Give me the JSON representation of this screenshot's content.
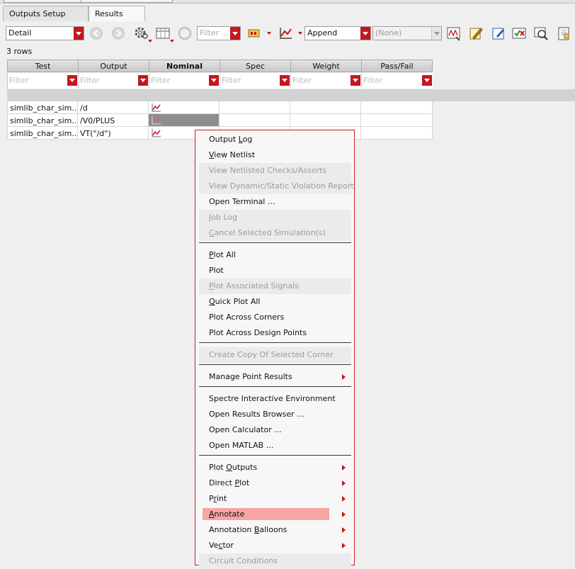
{
  "tabs": [
    {
      "label": "Outputs Setup"
    },
    {
      "label": "Results",
      "active": true
    }
  ],
  "toolbar": {
    "view_select": "Detail",
    "filter_placeholder": "Filter ...",
    "mode_select": "Append",
    "history_select": "(None)"
  },
  "row_count": "3 rows",
  "table": {
    "columns": [
      "Test",
      "Output",
      "Nominal",
      "Spec",
      "Weight",
      "Pass/Fail"
    ],
    "filter_placeholder": "Filter",
    "rows": [
      {
        "test": "simlib_char_sim...",
        "output": "/d"
      },
      {
        "test": "simlib_char_sim...",
        "output": "/V0/PLUS"
      },
      {
        "test": "simlib_char_sim...",
        "output": "VT(\"/d\")"
      }
    ]
  },
  "context_menu": {
    "items": [
      {
        "pre": "Output ",
        "u": "L",
        "post": "og"
      },
      {
        "pre": "",
        "u": "V",
        "post": "iew Netlist"
      },
      {
        "pre": "View Netlisted Checks/Asserts",
        "u": "",
        "post": "",
        "disabled": true
      },
      {
        "pre": "View Dynamic/Static Violation Report",
        "u": "",
        "post": "",
        "disabled": true
      },
      {
        "pre": "Open Terminal ...",
        "u": "",
        "post": ""
      },
      {
        "pre": "",
        "u": "J",
        "post": "ob Log",
        "disabled": true
      },
      {
        "pre": "",
        "u": "C",
        "post": "ancel Selected Simulation(s)",
        "disabled": true
      },
      {
        "pre": "",
        "u": "P",
        "post": "lot All"
      },
      {
        "pre": "Plot",
        "u": "",
        "post": ""
      },
      {
        "pre": "",
        "u": "P",
        "post": "lot Associated Signals",
        "disabled": true
      },
      {
        "pre": "",
        "u": "Q",
        "post": "uick Plot All"
      },
      {
        "pre": "Plot Across Corners",
        "u": "",
        "post": ""
      },
      {
        "pre": "Plot Across Design Points",
        "u": "",
        "post": ""
      },
      {
        "pre": "Create Copy Of Selected Corner",
        "u": "",
        "post": "",
        "disabled": true
      },
      {
        "pre": "Manage Point Results",
        "u": "",
        "post": "",
        "submenu": true
      },
      {
        "pre": "Spectre Interactive Environment",
        "u": "",
        "post": ""
      },
      {
        "pre": "Open Results Browser ...",
        "u": "",
        "post": ""
      },
      {
        "pre": "Open Calculator ...",
        "u": "",
        "post": ""
      },
      {
        "pre": "Open MATLAB ...",
        "u": "",
        "post": ""
      },
      {
        "pre": "Plot ",
        "u": "O",
        "post": "utputs",
        "submenu": true
      },
      {
        "pre": "Direct ",
        "u": "P",
        "post": "lot",
        "submenu": true
      },
      {
        "pre": "P",
        "u": "r",
        "post": "int",
        "submenu": true
      },
      {
        "pre": "",
        "u": "A",
        "post": "nnotate",
        "submenu": true,
        "highlighted": true
      },
      {
        "pre": "Annotation ",
        "u": "B",
        "post": "alloons",
        "submenu": true
      },
      {
        "pre": "Ve",
        "u": "c",
        "post": "tor",
        "submenu": true
      },
      {
        "pre": "Circuit Conditions",
        "u": "",
        "post": "",
        "disabled": true
      }
    ]
  },
  "colors": {
    "accent_red": "#c4161c",
    "menu_border": "#cf1b22",
    "highlight": "#f6a6a4"
  }
}
